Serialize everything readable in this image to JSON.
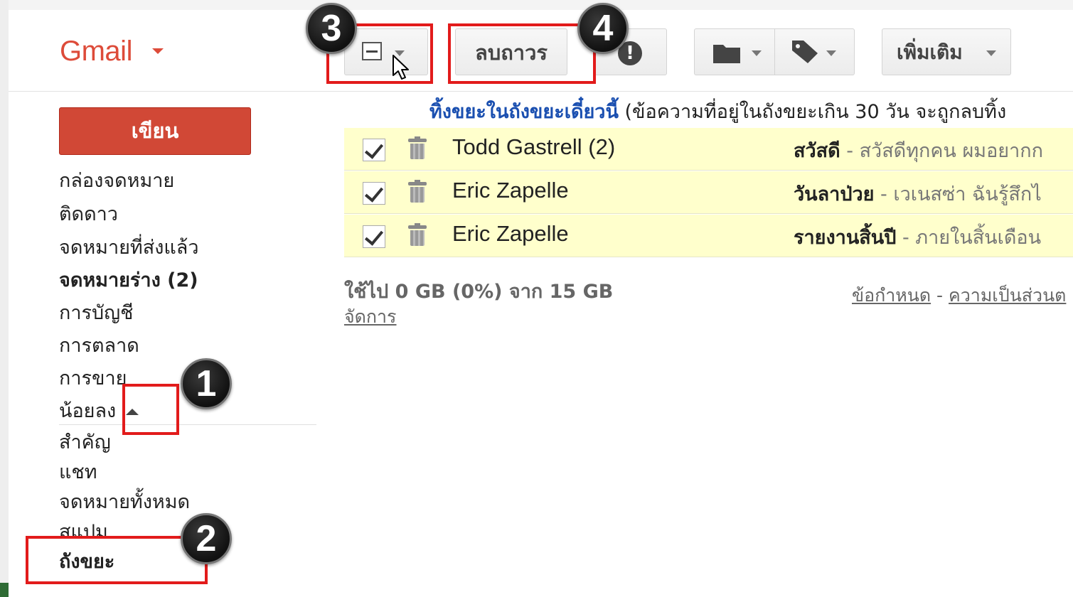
{
  "header": {
    "logo": "Gmail",
    "toolbar": {
      "delete_forever_label": "ลบถาวร",
      "more_label": "เพิ่มเติม"
    }
  },
  "sidebar": {
    "compose_label": "เขียน",
    "items": [
      {
        "label": "กล่องจดหมาย"
      },
      {
        "label": "ติดดาว"
      },
      {
        "label": "จดหมายที่ส่งแล้ว"
      },
      {
        "label": "จดหมายร่าง (2)"
      },
      {
        "label": "การบัญชี"
      },
      {
        "label": "การตลาด"
      },
      {
        "label": "การขาย"
      },
      {
        "label": "น้อยลง"
      },
      {
        "label": "สำคัญ"
      },
      {
        "label": "แชท"
      },
      {
        "label": "จดหมายทั้งหมด"
      },
      {
        "label": "สแปม"
      },
      {
        "label": "ถังขยะ"
      }
    ]
  },
  "trash_bar": {
    "link": "ทิ้งขยะในถังขยะเดี๋ยวนี้",
    "note": "(ข้อความที่อยู่ในถังขยะเกิน 30 วัน จะถูกลบทิ้ง"
  },
  "messages": [
    {
      "sender": "Todd Gastrell (2)",
      "subject": "สวัสดี",
      "snippet": " - สวัสดีทุกคน ผมอยากก",
      "checked": true
    },
    {
      "sender": "Eric Zapelle",
      "subject": "วันลาป่วย",
      "snippet": " - เวเนสซ่า ฉันรู้สึกไ",
      "checked": true
    },
    {
      "sender": "Eric Zapelle",
      "subject": "รายงานสิ้นปี",
      "snippet": " - ภายในสิ้นเดือน",
      "checked": true
    }
  ],
  "footer": {
    "storage": "ใช้ไป 0 GB (0%) จาก 15 GB",
    "manage": "จัดการ",
    "terms": "ข้อกำหนด",
    "separator": " - ",
    "privacy": "ความเป็นส่วนต"
  },
  "annotations": {
    "step1": "1",
    "step2": "2",
    "step3": "3",
    "step4": "4",
    "highlight_color": "#e21b1b"
  },
  "colors": {
    "brand": "#dd4b39",
    "compose": "#d14836",
    "selected_row": "#ffffcc",
    "link": "#1a4fb0"
  }
}
